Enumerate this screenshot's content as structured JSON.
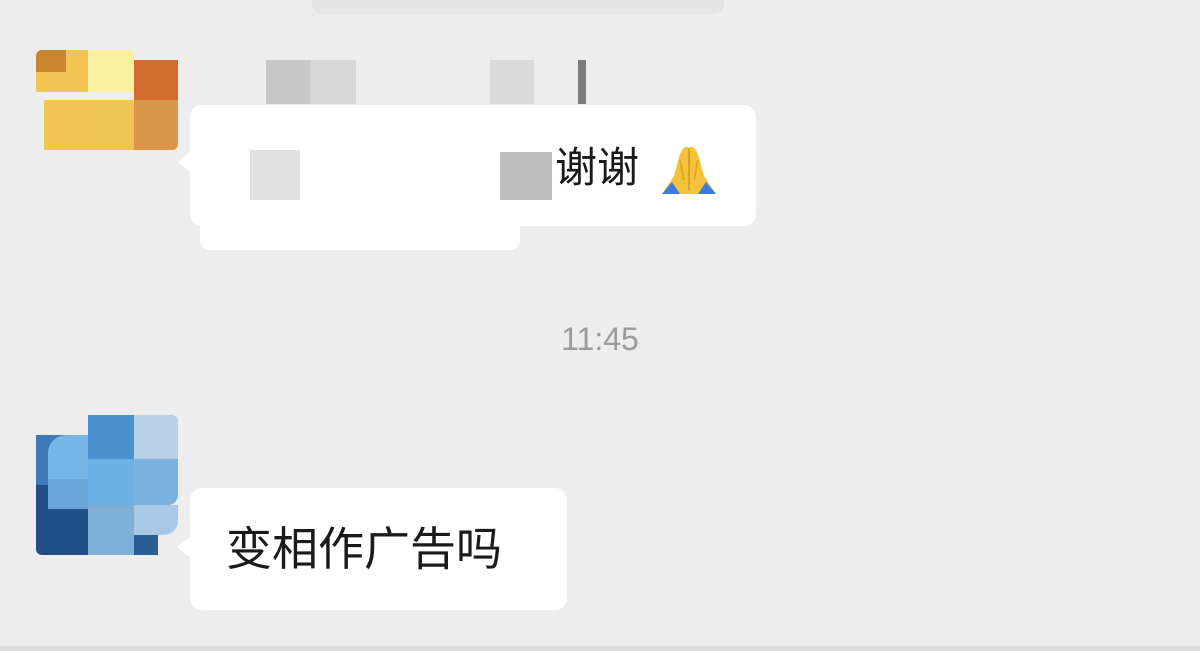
{
  "chat": {
    "messages": [
      {
        "text": "谢谢",
        "emoji_icon": "folded-hands-icon"
      },
      {
        "text": "变相作广告吗"
      }
    ],
    "timestamp": "11:45"
  },
  "colors": {
    "background": "#ededed",
    "bubble": "#ffffff",
    "timestamp": "#9b9b9b"
  }
}
